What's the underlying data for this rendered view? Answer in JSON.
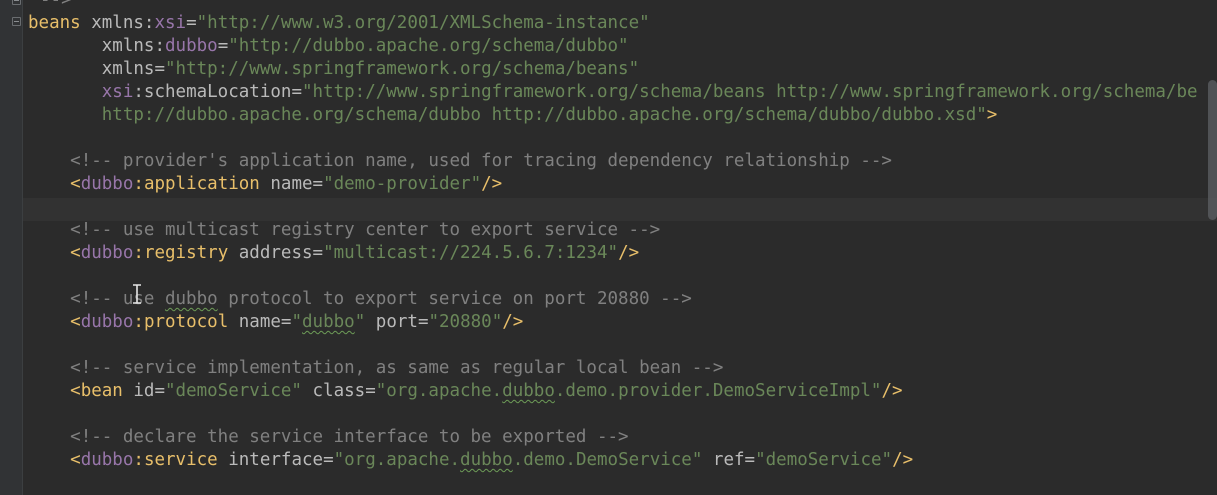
{
  "editor": {
    "language": "xml",
    "lines": [
      {
        "tokens": [
          {
            "t": "-->",
            "c": "cmt"
          }
        ]
      },
      {
        "tokens": [
          {
            "t": "beans",
            "c": "tag"
          },
          {
            "t": " ",
            "c": "attr"
          },
          {
            "t": "xmlns",
            "c": "attr"
          },
          {
            "t": ":",
            "c": "eq"
          },
          {
            "t": "xsi",
            "c": "ns"
          },
          {
            "t": "=",
            "c": "eq"
          },
          {
            "t": "\"http://www.w3.org/2001/XMLSchema-instance\"",
            "c": "val"
          }
        ]
      },
      {
        "tokens": [
          {
            "t": "       ",
            "c": "attr"
          },
          {
            "t": "xmlns",
            "c": "attr"
          },
          {
            "t": ":",
            "c": "eq"
          },
          {
            "t": "dubbo",
            "c": "ns"
          },
          {
            "t": "=",
            "c": "eq"
          },
          {
            "t": "\"http://dubbo.apache.org/schema/dubbo\"",
            "c": "val"
          }
        ]
      },
      {
        "tokens": [
          {
            "t": "       ",
            "c": "attr"
          },
          {
            "t": "xmlns",
            "c": "attr"
          },
          {
            "t": "=",
            "c": "eq"
          },
          {
            "t": "\"http://www.springframework.org/schema/beans\"",
            "c": "val"
          }
        ]
      },
      {
        "tokens": [
          {
            "t": "       ",
            "c": "attr"
          },
          {
            "t": "xsi",
            "c": "ns"
          },
          {
            "t": ":",
            "c": "eq"
          },
          {
            "t": "schemaLocation",
            "c": "attr"
          },
          {
            "t": "=",
            "c": "eq"
          },
          {
            "t": "\"http://www.springframework.org/schema/beans http://www.springframework.org/schema/be",
            "c": "val"
          }
        ]
      },
      {
        "tokens": [
          {
            "t": "       ",
            "c": "attr"
          },
          {
            "t": "http://dubbo.apache.org/schema/dubbo http://dubbo.apache.org/schema/dubbo/dubbo.xsd\"",
            "c": "val"
          },
          {
            "t": ">",
            "c": "tag"
          }
        ]
      },
      {
        "tokens": []
      },
      {
        "tokens": [
          {
            "t": "    ",
            "c": "attr"
          },
          {
            "t": "<!-- provider's application name, used for tracing dependency relationship -->",
            "c": "cmt"
          }
        ]
      },
      {
        "tokens": [
          {
            "t": "    ",
            "c": "attr"
          },
          {
            "t": "<",
            "c": "tag"
          },
          {
            "t": "dubbo",
            "c": "ns"
          },
          {
            "t": ":",
            "c": "tag"
          },
          {
            "t": "application",
            "c": "tag"
          },
          {
            "t": " name",
            "c": "attr"
          },
          {
            "t": "=",
            "c": "eq"
          },
          {
            "t": "\"demo-provider\"",
            "c": "val"
          },
          {
            "t": "/>",
            "c": "tag"
          }
        ]
      },
      {
        "tokens": []
      },
      {
        "tokens": [
          {
            "t": "    ",
            "c": "attr"
          },
          {
            "t": "<!-- use multicast registry center to export service -->",
            "c": "cmt"
          }
        ]
      },
      {
        "tokens": [
          {
            "t": "    ",
            "c": "attr"
          },
          {
            "t": "<",
            "c": "tag"
          },
          {
            "t": "dubbo",
            "c": "ns"
          },
          {
            "t": ":",
            "c": "tag"
          },
          {
            "t": "registry",
            "c": "tag"
          },
          {
            "t": " address",
            "c": "attr"
          },
          {
            "t": "=",
            "c": "eq"
          },
          {
            "t": "\"multicast://224.5.6.7:1234\"",
            "c": "val"
          },
          {
            "t": "/>",
            "c": "tag"
          }
        ]
      },
      {
        "tokens": []
      },
      {
        "tokens": [
          {
            "t": "    ",
            "c": "attr"
          },
          {
            "t": "<!-- use ",
            "c": "cmt"
          },
          {
            "t": "dubbo",
            "c": "cmt squig"
          },
          {
            "t": " protocol to export service on port 20880 -->",
            "c": "cmt"
          }
        ]
      },
      {
        "tokens": [
          {
            "t": "    ",
            "c": "attr"
          },
          {
            "t": "<",
            "c": "tag"
          },
          {
            "t": "dubbo",
            "c": "ns"
          },
          {
            "t": ":",
            "c": "tag"
          },
          {
            "t": "protocol",
            "c": "tag"
          },
          {
            "t": " name",
            "c": "attr"
          },
          {
            "t": "=",
            "c": "eq"
          },
          {
            "t": "\"",
            "c": "val"
          },
          {
            "t": "dubbo",
            "c": "val squig"
          },
          {
            "t": "\"",
            "c": "val"
          },
          {
            "t": " port",
            "c": "attr"
          },
          {
            "t": "=",
            "c": "eq"
          },
          {
            "t": "\"20880\"",
            "c": "val"
          },
          {
            "t": "/>",
            "c": "tag"
          }
        ]
      },
      {
        "tokens": []
      },
      {
        "tokens": [
          {
            "t": "    ",
            "c": "attr"
          },
          {
            "t": "<!-- service implementation, as same as regular local bean -->",
            "c": "cmt"
          }
        ]
      },
      {
        "tokens": [
          {
            "t": "    ",
            "c": "attr"
          },
          {
            "t": "<bean",
            "c": "tag"
          },
          {
            "t": " id",
            "c": "attr"
          },
          {
            "t": "=",
            "c": "eq"
          },
          {
            "t": "\"demoService\"",
            "c": "val"
          },
          {
            "t": " class",
            "c": "attr"
          },
          {
            "t": "=",
            "c": "eq"
          },
          {
            "t": "\"org.apache.",
            "c": "val"
          },
          {
            "t": "dubbo",
            "c": "val squig"
          },
          {
            "t": ".demo.provider.DemoServiceImpl\"",
            "c": "val"
          },
          {
            "t": "/>",
            "c": "tag"
          }
        ]
      },
      {
        "tokens": []
      },
      {
        "tokens": [
          {
            "t": "    ",
            "c": "attr"
          },
          {
            "t": "<!-- declare the service interface to be exported -->",
            "c": "cmt"
          }
        ]
      },
      {
        "tokens": [
          {
            "t": "    ",
            "c": "attr"
          },
          {
            "t": "<",
            "c": "tag"
          },
          {
            "t": "dubbo",
            "c": "ns"
          },
          {
            "t": ":",
            "c": "tag"
          },
          {
            "t": "service",
            "c": "tag"
          },
          {
            "t": " interface",
            "c": "attr"
          },
          {
            "t": "=",
            "c": "eq"
          },
          {
            "t": "\"org.apache.",
            "c": "val"
          },
          {
            "t": "dubbo",
            "c": "val squig"
          },
          {
            "t": ".demo.DemoService\"",
            "c": "val"
          },
          {
            "t": " ref",
            "c": "attr"
          },
          {
            "t": "=",
            "c": "eq"
          },
          {
            "t": "\"demoService\"",
            "c": "val"
          },
          {
            "t": "/>",
            "c": "tag"
          }
        ]
      }
    ]
  },
  "colors": {
    "background": "#2b2b2b",
    "tag": "#e8bf6a",
    "namespace": "#9876aa",
    "attribute": "#bababa",
    "string": "#6a8759",
    "comment": "#808080"
  }
}
